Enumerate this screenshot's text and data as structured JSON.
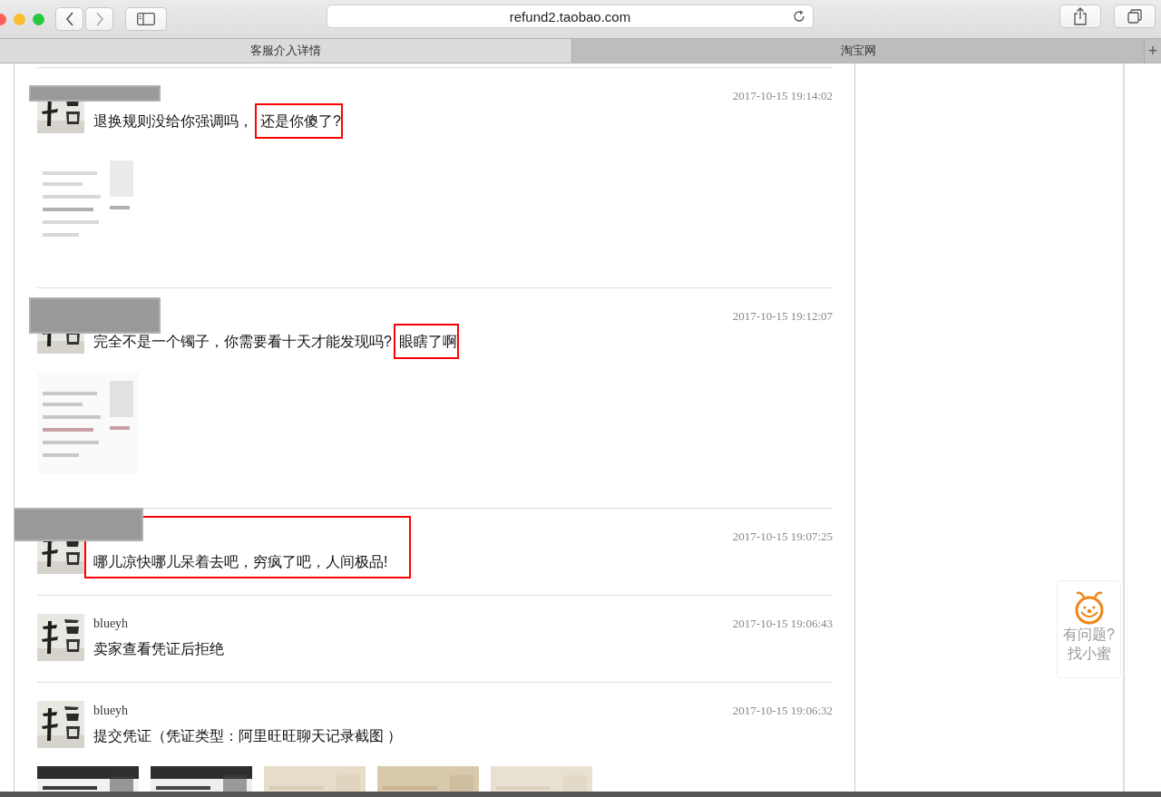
{
  "browser": {
    "address": "refund2.taobao.com"
  },
  "tabs": [
    {
      "label": "客服介入详情",
      "selected": true
    },
    {
      "label": "淘宝网",
      "selected": false
    }
  ],
  "new_tab": "+",
  "messages": [
    {
      "redacted": true,
      "time": "2017-10-15 19:14:02",
      "parts": [
        {
          "text": "退换规则没给你强调吗，",
          "highlighted": false
        },
        {
          "text": "还是你傻了?",
          "highlighted": true
        }
      ],
      "attachments": [
        {
          "kind": "picture"
        }
      ]
    },
    {
      "redacted": true,
      "time": "2017-10-15 19:12:07",
      "parts": [
        {
          "text": "完全不是一个镯子，你需要看十天才能发现吗?",
          "highlighted": false
        },
        {
          "text": "眼瞎了啊",
          "highlighted": true
        }
      ],
      "attachments": [
        {
          "kind": "picture"
        }
      ]
    },
    {
      "redacted": true,
      "time": "2017-10-15 19:07:25",
      "parts": [
        {
          "text": "哪儿凉快哪儿呆着去吧，穷疯了吧，人间极品!",
          "highlighted": true
        }
      ]
    },
    {
      "redacted": false,
      "name": "blueyh",
      "time": "2017-10-15 19:06:43",
      "parts": [
        {
          "text": "卖家查看凭证后拒绝",
          "highlighted": false
        }
      ]
    },
    {
      "redacted": false,
      "name": "blueyh",
      "time": "2017-10-15 19:06:32",
      "parts": [
        {
          "text": "提交凭证（凭证类型：阿里旺旺聊天记录截图 ）",
          "highlighted": false
        }
      ],
      "attachments": [
        {
          "kind": "picture"
        },
        {
          "kind": "picture"
        },
        {
          "kind": "picture"
        },
        {
          "kind": "picture"
        },
        {
          "kind": "picture"
        }
      ]
    }
  ],
  "helper": {
    "line1": "有问题?",
    "line2": "找小蜜"
  }
}
